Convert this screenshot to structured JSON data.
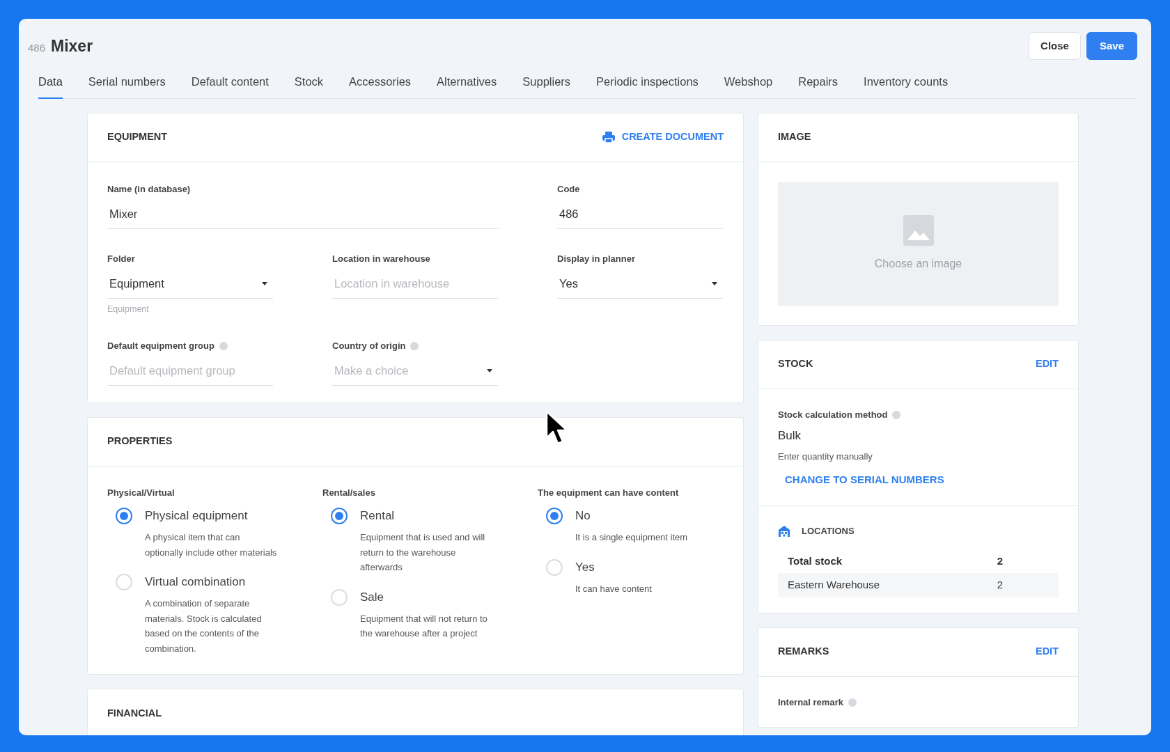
{
  "record": {
    "code": "486",
    "title": "Mixer"
  },
  "buttons": [
    {
      "label": "Close",
      "kind": "secondary"
    },
    {
      "label": "Save",
      "kind": "primary"
    }
  ],
  "tabs": [
    {
      "label": "Data",
      "selected": true
    },
    {
      "label": "Serial numbers",
      "selected": false
    },
    {
      "label": "Default content",
      "selected": false
    },
    {
      "label": "Stock",
      "selected": false
    },
    {
      "label": "Accessories",
      "selected": false
    },
    {
      "label": "Alternatives",
      "selected": false
    },
    {
      "label": "Suppliers",
      "selected": false
    },
    {
      "label": "Periodic inspections",
      "selected": false
    },
    {
      "label": "Webshop",
      "selected": false
    },
    {
      "label": "Repairs",
      "selected": false
    },
    {
      "label": "Inventory counts",
      "selected": false
    }
  ],
  "equipment": {
    "title": "EQUIPMENT",
    "action": "CREATE DOCUMENT",
    "fields": [
      {
        "label": "Name (in database)",
        "value": "Mixer",
        "kind": "text",
        "wide": true,
        "info": false
      },
      {
        "label": "Code",
        "value": "486",
        "kind": "text",
        "wide": false,
        "info": false
      },
      {
        "label": "Folder",
        "value": "Equipment",
        "kind": "select",
        "wide": false,
        "info": false,
        "hint": "Equipment"
      },
      {
        "label": "Location in warehouse",
        "placeholder": "Location in warehouse",
        "kind": "text",
        "wide": false,
        "info": false
      },
      {
        "label": "Display in planner",
        "value": "Yes",
        "kind": "select",
        "wide": false,
        "info": false
      },
      {
        "label": "Default equipment group",
        "placeholder": "Default equipment group",
        "kind": "text",
        "wide": false,
        "info": true
      },
      {
        "label": "Country of origin",
        "placeholder": "Make a choice",
        "kind": "select",
        "wide": false,
        "info": true
      }
    ]
  },
  "properties": {
    "title": "PROPERTIES",
    "groups": [
      {
        "label": "Physical/Virtual",
        "options": [
          {
            "label": "Physical equipment",
            "description": "A physical item that can optionally include other materials",
            "selected": true
          },
          {
            "label": "Virtual combination",
            "description": "A combination of separate materials. Stock is calculated based on the contents of the combination.",
            "selected": false
          }
        ]
      },
      {
        "label": "Rental/sales",
        "options": [
          {
            "label": "Rental",
            "description": "Equipment that is used and will return to the warehouse afterwards",
            "selected": true
          },
          {
            "label": "Sale",
            "description": "Equipment that will not return to the warehouse after a project",
            "selected": false
          }
        ]
      },
      {
        "label": "The equipment can have content",
        "options": [
          {
            "label": "No",
            "description": "It is a single equipment item",
            "selected": true
          },
          {
            "label": "Yes",
            "description": "It can have content",
            "selected": false
          }
        ]
      }
    ]
  },
  "financial": {
    "title": "FINANCIAL"
  },
  "image": {
    "title": "IMAGE",
    "placeholder": "Choose an image"
  },
  "stock": {
    "title": "STOCK",
    "action": "EDIT",
    "method_label": "Stock calculation method",
    "method": "Bulk",
    "method_hint": "Enter quantity manually",
    "change_link": "CHANGE TO SERIAL NUMBERS",
    "locations_title": "LOCATIONS",
    "locations": [
      {
        "name": "Total stock",
        "count": "2",
        "kind": "total"
      },
      {
        "name": "Eastern Warehouse",
        "count": "2",
        "kind": "item"
      }
    ]
  },
  "remarks": {
    "title": "REMARKS",
    "action": "EDIT",
    "field_label": "Internal remark"
  }
}
